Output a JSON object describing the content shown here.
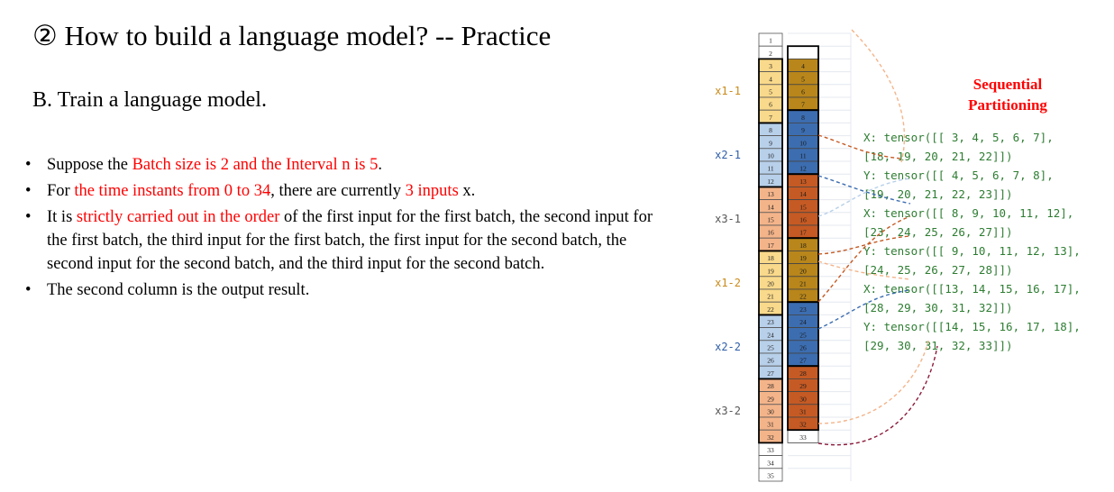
{
  "slide": {
    "title": "② How to build a language model? -- Practice",
    "subtitle": "B. Train a language model."
  },
  "bullets": [
    {
      "parts": [
        {
          "text": "Suppose the ",
          "red": false
        },
        {
          "text": "Batch size is 2 and the Interval n is 5",
          "red": true
        },
        {
          "text": ".",
          "red": false
        }
      ]
    },
    {
      "parts": [
        {
          "text": "For ",
          "red": false
        },
        {
          "text": "the time instants from 0 to 34",
          "red": true
        },
        {
          "text": ", there are currently ",
          "red": false
        },
        {
          "text": "3 inputs",
          "red": true
        },
        {
          "text": " x.",
          "red": false
        }
      ]
    },
    {
      "parts": [
        {
          "text": "It is ",
          "red": false
        },
        {
          "text": "strictly carried out in the order",
          "red": true
        },
        {
          "text": " of the first input for the first batch, the second input for the first batch, the third input for the first batch, the first input for the second batch, the second input for the second batch, and the third input for the second batch.",
          "red": false
        }
      ]
    },
    {
      "parts": [
        {
          "text": "The second column is the output result.",
          "red": false
        }
      ]
    }
  ],
  "diagram": {
    "heading_line1": "Sequential",
    "heading_line2": "Partitioning",
    "heading_color": "#ff0000",
    "groups": [
      {
        "label": "x1-1",
        "label_color": "#c98a1a",
        "start": 3,
        "end": 7,
        "col1": "#f9d98b",
        "col2": "#b8861b"
      },
      {
        "label": "x2-1",
        "label_color": "#2e5da8",
        "start": 8,
        "end": 12,
        "col1": "#b8d0ea",
        "col2": "#3c6db0"
      },
      {
        "label": "x3-1",
        "label_color": "#555555",
        "start": 13,
        "end": 17,
        "col1": "#f4b48a",
        "col2": "#c55a24"
      },
      {
        "label": "x1-2",
        "label_color": "#c98a1a",
        "start": 18,
        "end": 22,
        "col1": "#f9d98b",
        "col2": "#b8861b"
      },
      {
        "label": "x2-2",
        "label_color": "#2e5da8",
        "start": 23,
        "end": 27,
        "col1": "#b8d0ea",
        "col2": "#3c6db0"
      },
      {
        "label": "x3-2",
        "label_color": "#555555",
        "start": 28,
        "end": 32,
        "col1": "#f4b48a",
        "col2": "#c55a24"
      }
    ],
    "white_col1": [
      "1",
      "2",
      "33",
      "34",
      "35"
    ],
    "white_col2": [
      "33"
    ],
    "col1_numbers": [
      "1",
      "2",
      "3",
      "4",
      "5",
      "6",
      "7",
      "8",
      "9",
      "10",
      "11",
      "12",
      "13",
      "14",
      "15",
      "16",
      "17",
      "18",
      "19",
      "20",
      "21",
      "22",
      "23",
      "24",
      "25",
      "26",
      "27",
      "28",
      "29",
      "30",
      "31",
      "32",
      "33",
      "34",
      "35"
    ],
    "col2_numbers": [
      "4",
      "5",
      "6",
      "7",
      "8",
      "9",
      "10",
      "11",
      "12",
      "13",
      "14",
      "15",
      "16",
      "17",
      "18",
      "19",
      "20",
      "21",
      "22",
      "23",
      "24",
      "25",
      "26",
      "27",
      "28",
      "29",
      "30",
      "31",
      "32",
      "33"
    ],
    "tensor_lines": [
      "X:  tensor([[ 3,  4,  5,  6,  7],",
      "        [18, 19, 20, 21, 22]])",
      "Y: tensor([[ 4,  5,  6,  7,  8],",
      "        [19, 20, 21, 22, 23]])",
      "X:  tensor([[ 8,  9, 10, 11, 12],",
      "        [23, 24, 25, 26, 27]])",
      "Y: tensor([[ 9, 10, 11, 12, 13],",
      "        [24, 25, 26, 27, 28]])",
      "X:  tensor([[13, 14, 15, 16, 17],",
      "        [28, 29, 30, 31, 32]])",
      "Y: tensor([[14, 15, 16, 17, 18],",
      "        [29, 30, 31, 32, 33]])"
    ],
    "tensor_color": "#2e7d32"
  }
}
